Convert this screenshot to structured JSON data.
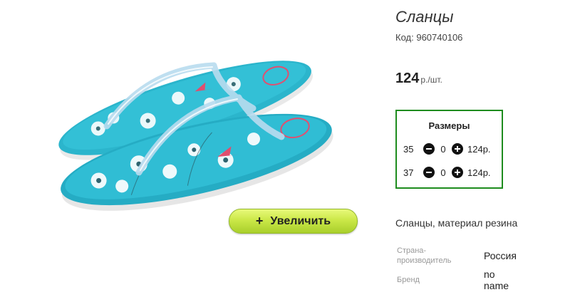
{
  "product": {
    "title": "Сланцы",
    "code_label": "Код:",
    "code": "960740106",
    "price": "124",
    "price_unit": "р./шт.",
    "description": "Сланцы, материал резина"
  },
  "zoom_button": {
    "icon": "plus-icon",
    "label": "Увеличить"
  },
  "sizes": {
    "title": "Размеры",
    "rows": [
      {
        "size": "35",
        "qty": "0",
        "price": "124р."
      },
      {
        "size": "37",
        "qty": "0",
        "price": "124р."
      }
    ]
  },
  "attributes": [
    {
      "label": "Страна-производитель",
      "value": "Россия"
    },
    {
      "label": "Бренд",
      "value": "no name"
    }
  ],
  "colors": {
    "sizes_border": "#1e8c1e",
    "button_green": "#cbe848",
    "sole": "#2bb5cc",
    "strap": "#b9dcef"
  }
}
